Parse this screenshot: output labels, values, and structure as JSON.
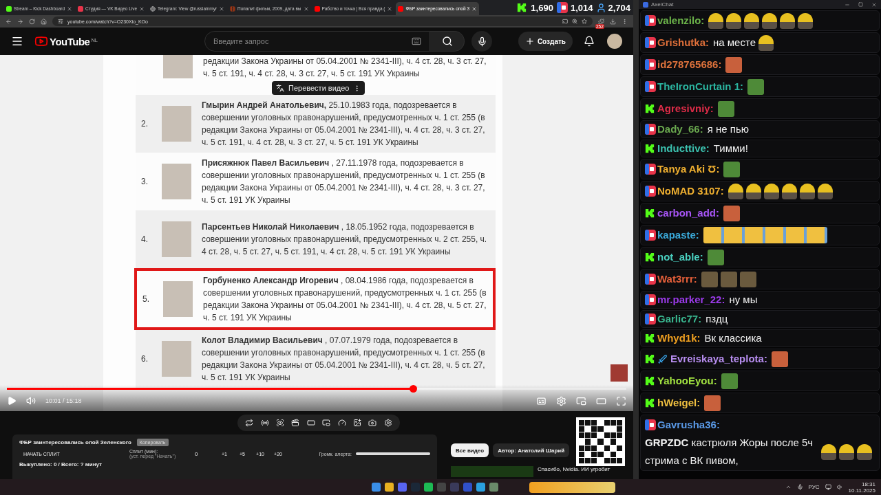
{
  "browser": {
    "tabs": [
      {
        "title": "Stream – Kick Dashboard",
        "kind": "kick",
        "selected": false
      },
      {
        "title": "Студия — VK Видео Live",
        "kind": "vk",
        "selected": false
      },
      {
        "title": "Telegram: View @russiainmyr",
        "kind": "globe",
        "selected": false
      },
      {
        "title": "Попали! фильм, 2009, дата вы",
        "kind": "film",
        "selected": false
      },
      {
        "title": "Рабство и точка | Вся правда (",
        "kind": "youtube",
        "selected": false
      },
      {
        "title": "ФБР заинтересовались опой З",
        "kind": "youtube",
        "selected": true
      }
    ],
    "viewer_counts": [
      {
        "kind": "kick",
        "count": "1,690"
      },
      {
        "kind": "vk",
        "count": "1,014"
      },
      {
        "kind": "total",
        "count": "2,704"
      }
    ],
    "address": "youtube.com/watch?v=O230Xio_KOo",
    "extension_badge": "252"
  },
  "youtube": {
    "logo": "YouTube",
    "region": "NL",
    "search_placeholder": "Введите запрос",
    "create_label": "Создать"
  },
  "video": {
    "translate_label": "Перевести видео",
    "rows": [
      {
        "text": "редакции Закона Украины от 05.04.2001 № 2341-III), ч. 4 ст. 28, ч. 3 ст. 27, ч. 5 ст. 191, ч. 4 ст. 28, ч. 3 ст. 27, ч. 5 ст. 191 УК Украины",
        "highlighted": false
      },
      {
        "number": "2.",
        "text": "**Гмырин Андрей Анатольевич,** 25.10.1983 года, подозревается в совершении уголовных правонарушений, предусмотренных ч. 1 ст. 255 (в редакции Закона Украины от 05.04.2001 № 2341-III), ч. 4 ст. 28, ч. 3 ст. 27, ч. 5 ст. 191, ч. 4 ст. 28, ч. 3 ст. 27, ч. 5 ст. 191 УК Украины",
        "highlighted": false
      },
      {
        "number": "3.",
        "text": "**Присяжнюк Павел Васильевич** , 27.11.1978 года, подозревается в совершении уголовных правонарушений, предусмотренных ч. 1 ст. 255 (в редакции Закона Украины от 05.04.2001 № 2341-III), ч. 4 ст. 28, ч. 3 ст. 27, ч. 5 ст. 191 УК Украины",
        "highlighted": false
      },
      {
        "number": "4.",
        "text": "**Парсентьев Николай Николаевич** , 18.05.1952 года, подозревается в совершении уголовных правонарушений, предусмотренных ч. 2 ст. 255, ч. 4 ст. 28, ч. 5 ст. 27, ч. 5 ст. 191, ч. 4 ст. 28, ч. 5 ст. 191 УК Украины",
        "highlighted": false
      },
      {
        "number": "5.",
        "text": "**Горбуненко Александр Игоревич** , 08.04.1986 года, подозревается в совершении уголовных правонарушений, предусмотренных ч. 1 ст. 255 (в редакции Закона Украины от 05.04.2001 № 2341-III), ч. 4 ст. 28, ч. 5 ст. 27, ч. 5 ст. 191 УК Украины",
        "highlighted": true
      },
      {
        "number": "6.",
        "text": "**Колот Владимир Васильевич** , 07.07.1979 года, подозревается в совершении уголовных правонарушений, предусмотренных ч. 1 ст. 255 (в редакции Закона Украины от 05.04.2001 № 2341-III), ч. 4 ст. 28, ч. 5 ст. 27, ч. 5 ст. 191 УК Украины",
        "highlighted": false
      }
    ],
    "time": "10:01 / 15:18",
    "level": 0.655
  },
  "tools_panel": {
    "title": "ФБР заинтересовались опой Зеленского",
    "copy_label": "Копировать",
    "split_button": "НАЧАТЬ СПЛИТ",
    "split_label": "Сплит (мин):",
    "split_hint": "(уст. перед \"Начать\")",
    "split_value": "0",
    "increments": [
      "+1",
      "+5",
      "+10",
      "+20"
    ],
    "alert_label": "Громк. алерта:",
    "alert_volume": {
      "level": 1
    },
    "footer": "Выкуплено: 0 / Всего: ? минут"
  },
  "related": {
    "chips": [
      {
        "label": "Все видео",
        "selected": true
      },
      {
        "label": "Автор: Анатолий Шарий",
        "selected": false
      }
    ],
    "video_title": "Спасибо, Nvidia. ИИ угробит"
  },
  "chat": {
    "title": "AxelChat",
    "messages": [
      {
        "kind": "vk",
        "name": "valenzilo:",
        "color": "#6cb44a",
        "emotes": [
          {
            "kind": "blob"
          },
          {
            "kind": "blob"
          },
          {
            "kind": "blob"
          },
          {
            "kind": "blob"
          },
          {
            "kind": "blob"
          },
          {
            "kind": "blob"
          }
        ]
      },
      {
        "kind": "vk",
        "name": "Grishutka:",
        "color": "#e0703a",
        "text": "на месте",
        "emotes": [
          {
            "kind": "blob"
          }
        ]
      },
      {
        "kind": "vk",
        "name": "id278765686:",
        "color": "#e0733c",
        "emotes": [
          {
            "kind": "face"
          }
        ]
      },
      {
        "kind": "vk",
        "name": "TheIronCurtain 1:",
        "color": "#2bb5a0",
        "emotes": [
          {
            "kind": "pepe"
          }
        ]
      },
      {
        "kind": "kick",
        "name": "Agresivniy:",
        "color": "#e02c48",
        "emotes": [
          {
            "kind": "pepe"
          }
        ]
      },
      {
        "kind": "vk",
        "name": "Dady_66:",
        "color": "#6aa84f",
        "text": "я не пью"
      },
      {
        "kind": "kick",
        "name": "Inducttive:",
        "color": "#3cc2b0",
        "text": "Тимми!"
      },
      {
        "kind": "vk",
        "name": "Tanya Aki Ʊ:",
        "color": "#f0b030",
        "emotes": [
          {
            "kind": "pepe"
          }
        ]
      },
      {
        "kind": "vk",
        "name": "NoMAD 3107:",
        "color": "#f0b030",
        "emotes": [
          {
            "kind": "blob"
          },
          {
            "kind": "blob"
          },
          {
            "kind": "blob"
          },
          {
            "kind": "blob"
          },
          {
            "kind": "blob"
          },
          {
            "kind": "blob"
          }
        ]
      },
      {
        "kind": "kick",
        "name": "carbon_add:",
        "color": "#a855f7",
        "emotes": [
          {
            "kind": "face"
          }
        ]
      },
      {
        "kind": "vk",
        "name": "kapaste:",
        "color": "#3aa8d8",
        "emotes": [
          {
            "kind": "wide"
          }
        ]
      },
      {
        "kind": "kick",
        "name": "not_able:",
        "color": "#4ad0c0",
        "emotes": [
          {
            "kind": "pepe"
          }
        ]
      },
      {
        "kind": "vk",
        "name": "Wat3rrr:",
        "color": "#e8603a",
        "emotes": [
          {
            "kind": "figure"
          },
          {
            "kind": "figure"
          },
          {
            "kind": "figure"
          }
        ]
      },
      {
        "kind": "vk",
        "name": "mr.parker_22:",
        "color": "#9a3ae8",
        "text": "ну мы"
      },
      {
        "kind": "vk",
        "name": "Garlic77:",
        "color": "#3ab890",
        "text": "пздц"
      },
      {
        "kind": "kick",
        "name": "Whyd1k:",
        "color": "#f0a020",
        "text": "Вк классика"
      },
      {
        "kind": "kick",
        "badges": [
          {
            "kind": "sword"
          }
        ],
        "name": "Evreiskaya_teplota:",
        "color": "#b88ef0",
        "emotes": [
          {
            "kind": "face"
          }
        ]
      },
      {
        "kind": "kick",
        "name": "YahooEyou:",
        "color": "#a0e040",
        "emotes": [
          {
            "kind": "pepe"
          }
        ]
      },
      {
        "kind": "kick",
        "name": "hWeigel:",
        "color": "#f0c040",
        "emotes": [
          {
            "kind": "face"
          }
        ]
      },
      {
        "kind": "vk",
        "name": "Gavrusha36:",
        "color": "#5a9ae8",
        "text": "**GRPZDC** кастрюля Жоры после 5ч стрима с ВК пивом,",
        "emotes": [
          {
            "kind": "blob"
          },
          {
            "kind": "blob"
          },
          {
            "kind": "blob"
          }
        ]
      }
    ]
  },
  "taskbar": {
    "language": "РУС",
    "time": "18:31",
    "date": "10.11.2025"
  }
}
